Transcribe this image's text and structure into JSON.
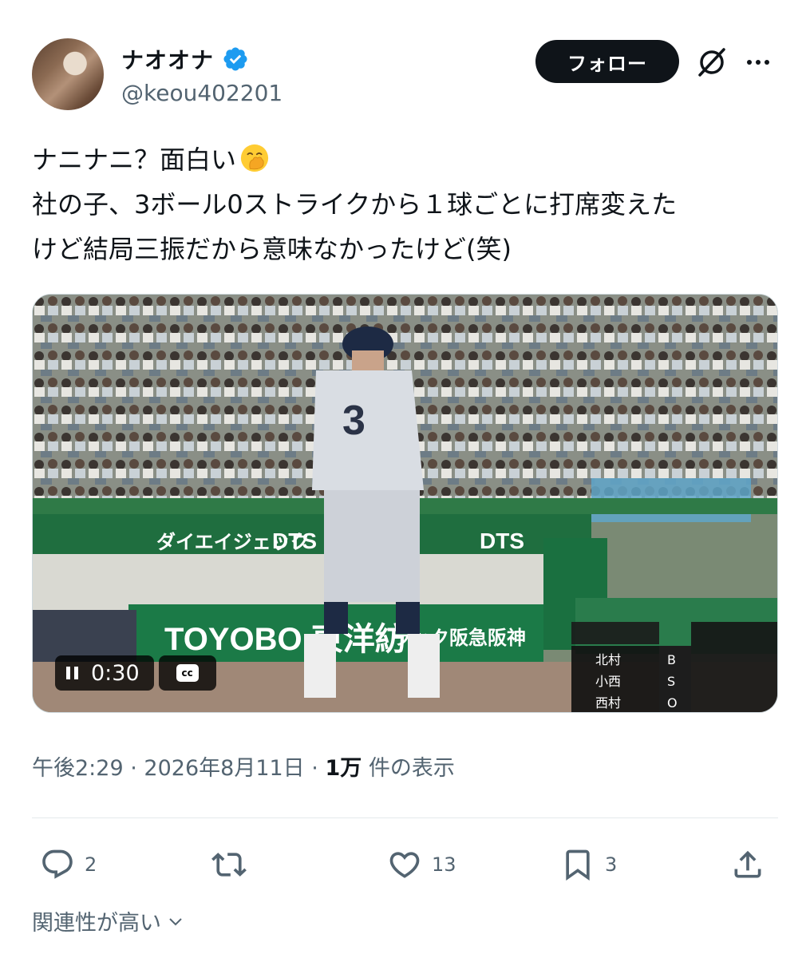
{
  "author": {
    "display_name": "ナオオナ",
    "handle": "@keou402201",
    "verified": true
  },
  "header": {
    "follow_label": "フォロー",
    "grok_icon": "grok-icon",
    "more_icon": "more-options-icon"
  },
  "tweet": {
    "lines": [
      "ナニナニ？面白い",
      "社の子、3ボール0ストライクから１球ごとに打席変えた",
      "けど結局三振だから意味なかったけど(笑)"
    ],
    "emoji": "hand-over-mouth-emoji"
  },
  "media": {
    "type": "video",
    "time": "0:30",
    "cc_label": "cc",
    "player_number": "3",
    "banners": [
      "TOYOBO 東洋紡",
      "ダイエイジェック",
      "DTS",
      "ラック阪急阪神"
    ],
    "scoreboard_names": [
      "北村",
      "小西",
      "西村"
    ],
    "scoreboard_counts": [
      "B",
      "S",
      "O"
    ]
  },
  "meta": {
    "time": "午後2:29",
    "sep": "·",
    "date": "2026年8月11日",
    "views_count": "1万",
    "views_label": "件の表示"
  },
  "actions": {
    "replies": "2",
    "likes": "13",
    "bookmarks": "3"
  },
  "relevance_label": "関連性が高い",
  "colors": {
    "text": "#0f1419",
    "secondary": "#536471",
    "verified": "#1d9bf0",
    "divider": "#e4e9ec"
  }
}
